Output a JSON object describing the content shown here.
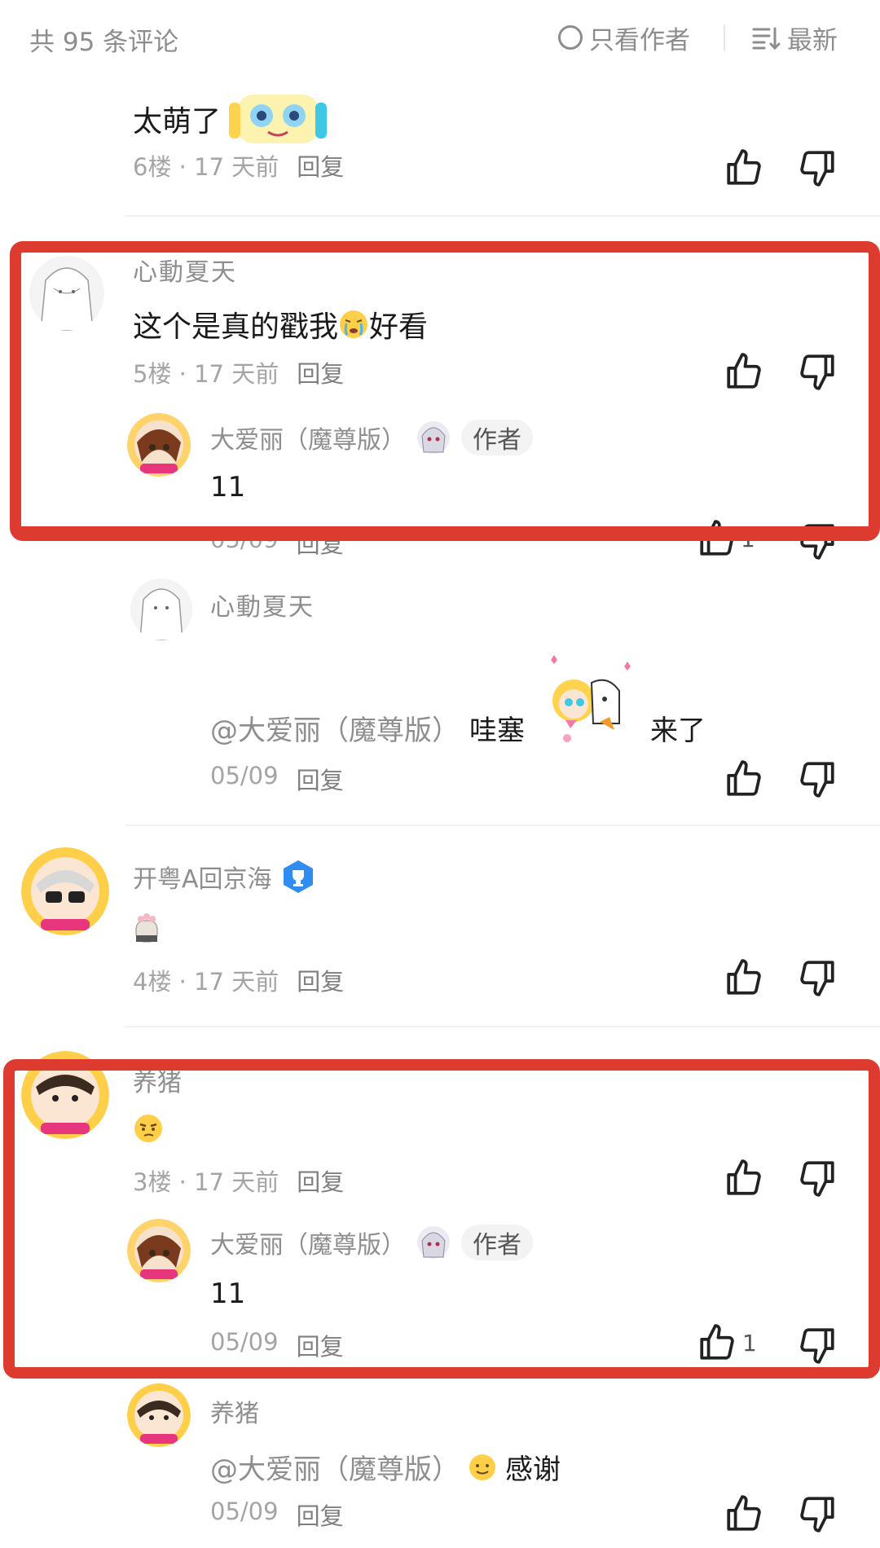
{
  "header": {
    "count_label": "共 95 条评论",
    "author_only_label": "只看作者",
    "sort_label": "最新"
  },
  "comments": [
    {
      "text": "太萌了",
      "floor": "6楼 · 17 天前",
      "reply": "回复"
    },
    {
      "username": "心動夏天",
      "text_before": "这个是真的戳我",
      "text_after": "好看",
      "floor": "5楼 · 17 天前",
      "reply": "回复",
      "replies": [
        {
          "username": "大爱丽（魔尊版）",
          "badge": "作者",
          "text": "11",
          "date": "05/09",
          "reply": "回复",
          "likes": "1"
        },
        {
          "username": "心動夏天",
          "mention": "@大爱丽（魔尊版）",
          "text_before": "哇塞",
          "text_after": "来了",
          "date": "05/09",
          "reply": "回复"
        }
      ]
    },
    {
      "username": "开粤A回京海",
      "floor": "4楼 · 17 天前",
      "reply": "回复"
    },
    {
      "username": "养猪",
      "floor": "3楼 · 17 天前",
      "reply": "回复",
      "replies": [
        {
          "username": "大爱丽（魔尊版）",
          "badge": "作者",
          "text": "11",
          "date": "05/09",
          "reply": "回复",
          "likes": "1"
        },
        {
          "username": "养猪",
          "mention": "@大爱丽（魔尊版）",
          "text_after": "感谢",
          "date": "05/09",
          "reply": "回复"
        }
      ]
    }
  ],
  "colors": {
    "highlight": "#dd3b30",
    "verified": "#2f8cf0"
  },
  "icons": [
    "thumbs-up-icon",
    "thumbs-down-icon",
    "radio-icon",
    "sort-icon",
    "verified-trophy-icon"
  ]
}
